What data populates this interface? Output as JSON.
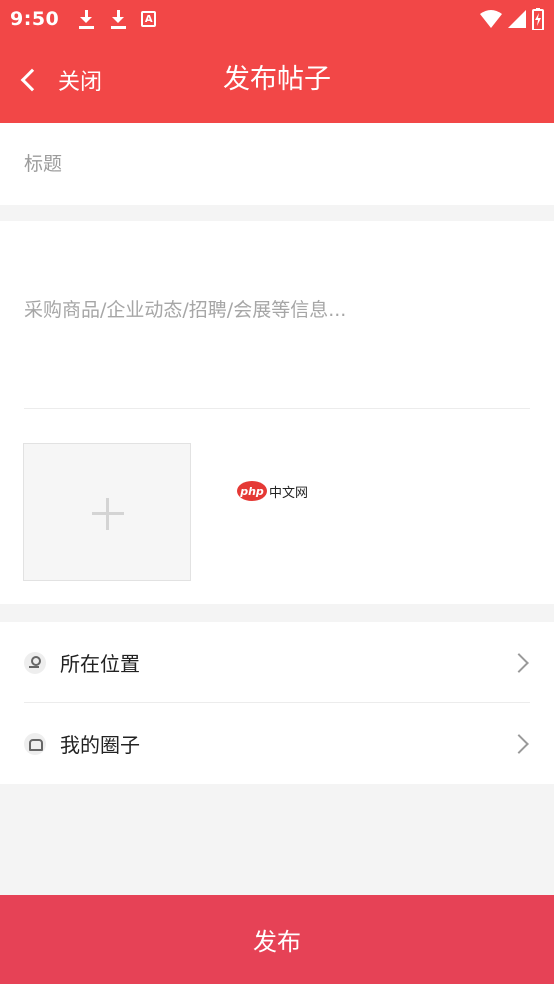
{
  "status_bar": {
    "time": "9:50",
    "notification_icons": [
      "download-icon",
      "download-icon",
      "a-icon"
    ],
    "system_icons": [
      "wifi-icon",
      "cell-signal-icon",
      "battery-icon"
    ]
  },
  "header": {
    "back_label": "关闭",
    "title": "发布帖子",
    "background_color": "#f24747"
  },
  "form": {
    "title_placeholder": "标题",
    "content_placeholder": "采购商品/企业动态/招聘/会展等信息...",
    "add_image_icon": "plus-icon"
  },
  "watermark": {
    "logo_text": "php",
    "text": "中文网"
  },
  "options": [
    {
      "label": "所在位置",
      "icon": "location-icon"
    },
    {
      "label": "我的圈子",
      "icon": "group-icon"
    }
  ],
  "footer": {
    "publish_label": "发布",
    "background_color": "#e64256"
  }
}
